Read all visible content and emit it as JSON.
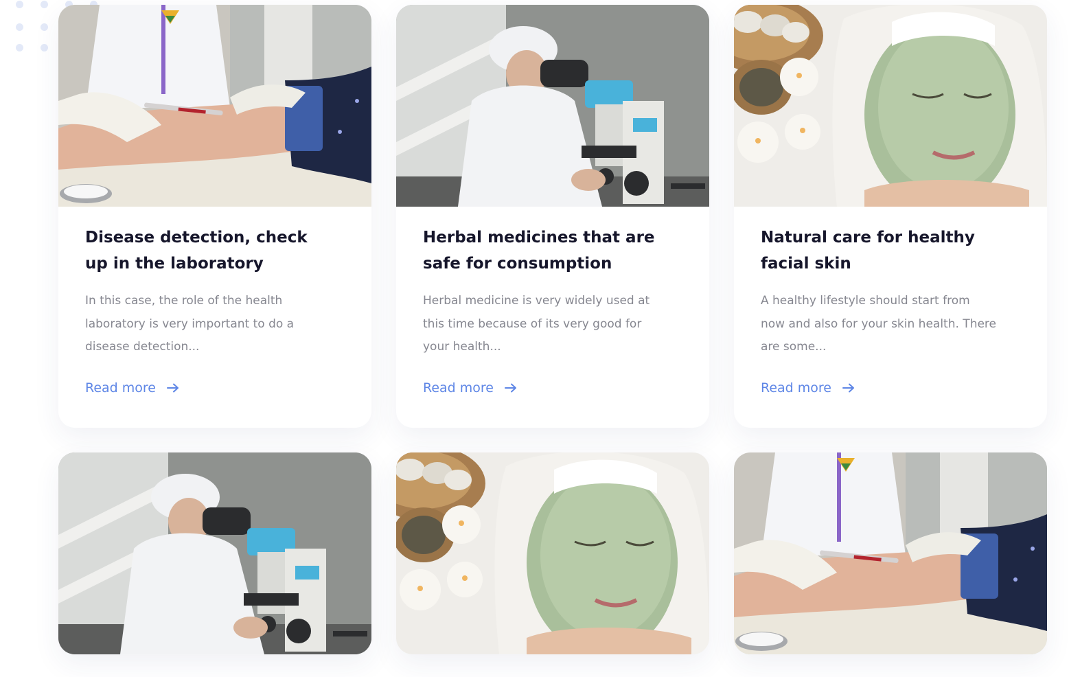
{
  "posts": [
    {
      "title": "Disease detection, check up in the laboratory",
      "excerpt": "In this case, the role of the health laboratory is very important to do a disease detection...",
      "link": "Read more",
      "image": "blood-draw-photo"
    },
    {
      "title": "Herbal medicines that are safe for consumption",
      "excerpt": "Herbal medicine is very widely used at this time because of its very good for your health...",
      "link": "Read more",
      "image": "microscope-lab-photo"
    },
    {
      "title": "Natural care for healthy facial skin",
      "excerpt": "A healthy lifestyle should start from now and also for your skin health. There are some...",
      "link": "Read more",
      "image": "facial-mask-photo"
    },
    {
      "title": "",
      "excerpt": "",
      "link": "",
      "image": "microscope-lab-photo"
    },
    {
      "title": "",
      "excerpt": "",
      "link": "",
      "image": "facial-mask-photo"
    },
    {
      "title": "",
      "excerpt": "",
      "link": "",
      "image": "blood-draw-photo"
    }
  ],
  "colors": {
    "title": "#16162b",
    "excerpt": "#868790",
    "link": "#5e86e6",
    "dots": "#e3e9f8"
  },
  "icons": {
    "read_more": "arrow-right-icon",
    "decoration": "dot-grid-pattern"
  }
}
